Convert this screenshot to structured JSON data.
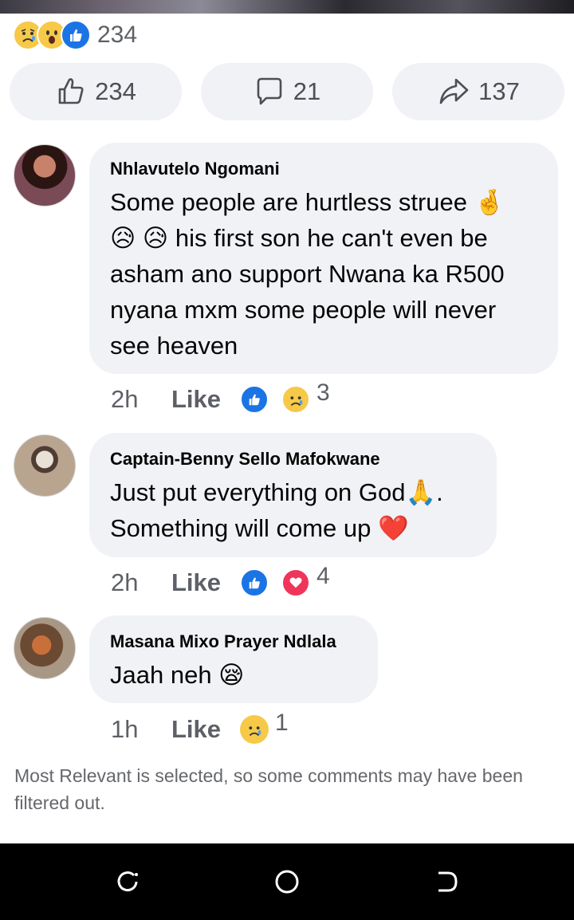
{
  "post": {
    "reaction_icons": [
      "sad-react-icon",
      "wow-react-icon",
      "like-react-icon"
    ],
    "reaction_total": "234"
  },
  "actions": {
    "like_count": "234",
    "comment_count": "21",
    "share_count": "137"
  },
  "comments": [
    {
      "author": "Nhlavutelo Ngomani",
      "text": "Some people are hurtless struee 🤞 😥 😥 his first son he can't even be asham ano support Nwana ka R500 nyana mxm some people will never see heaven",
      "time": "2h",
      "like_label": "Like",
      "reactions": [
        "like",
        "sad"
      ],
      "reaction_count": "3"
    },
    {
      "author": "Captain-Benny Sello Mafokwane",
      "text": "Just put everything on God🙏. Something will come up ❤️",
      "time": "2h",
      "like_label": "Like",
      "reactions": [
        "like",
        "love"
      ],
      "reaction_count": "4"
    },
    {
      "author": "Masana Mixo Prayer Ndlala",
      "text": "Jaah neh 😪",
      "time": "1h",
      "like_label": "Like",
      "reactions": [
        "sad"
      ],
      "reaction_count": "1"
    }
  ],
  "footer_note": "Most Relevant is selected, so some comments may have been filtered out.",
  "nav": {
    "buttons": [
      "recent-apps-icon",
      "home-icon",
      "back-icon"
    ]
  },
  "colors": {
    "like_blue": "#1b74e4",
    "love_red": "#f0355a",
    "emoji_yellow": "#f7c948",
    "bubble_grey": "#f0f2f5",
    "secondary_text": "#65676b"
  }
}
